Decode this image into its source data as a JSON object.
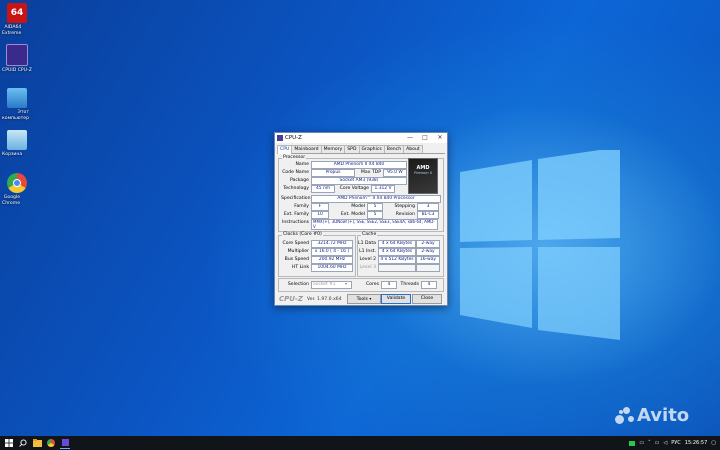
{
  "desktop": {
    "icons": [
      {
        "label": "AIDA64\nExtreme",
        "glyph": "64",
        "icon": "aida64-icon",
        "color": "#c81414"
      },
      {
        "label": "CPUID CPU-Z",
        "glyph": "",
        "icon": "cpuz-icon",
        "color": "#3a2a8a"
      },
      {
        "label": "Этот\nкомпьютер",
        "glyph": "",
        "icon": "computer-icon",
        "color": "#2a8ad8"
      },
      {
        "label": "Корзина",
        "glyph": "",
        "icon": "recycle-bin-icon",
        "color": "#6ab0e0"
      },
      {
        "label": "Google\nChrome",
        "glyph": "",
        "icon": "chrome-icon",
        "color": "#e84a3a"
      }
    ]
  },
  "window": {
    "title": "CPU-Z",
    "controls": {
      "minimize": "—",
      "maximize": "□",
      "close": "✕"
    },
    "tabs": [
      "CPU",
      "Mainboard",
      "Memory",
      "SPD",
      "Graphics",
      "Bench",
      "About"
    ],
    "active_tab": "CPU",
    "processor": {
      "group_label": "Processor",
      "name_label": "Name",
      "name": "AMD Phenom II X4 840",
      "codename_label": "Code Name",
      "codename": "Propus",
      "maxtdp_label": "Max TDP",
      "maxtdp": "95.0 W",
      "package_label": "Package",
      "package": "Socket AM3 (938)",
      "technology_label": "Technology",
      "technology": "45 nm",
      "corevoltage_label": "Core Voltage",
      "corevoltage": "1.312 V",
      "spec_label": "Specification",
      "spec": "AMD Phenom™ II X4 840 Processor",
      "family_label": "Family",
      "family": "F",
      "model_label": "Model",
      "model": "5",
      "stepping_label": "Stepping",
      "stepping": "3",
      "extfamily_label": "Ext. Family",
      "extfamily": "10",
      "extmodel_label": "Ext. Model",
      "extmodel": "5",
      "revision_label": "Revision",
      "revision": "BL-C3",
      "instructions_label": "Instructions",
      "instructions": "MMX(+), 3DNow!(+), SSE, SSE2, SSE3, SSE4A, x86-64, AMD-V"
    },
    "amd_logo": {
      "brand": "AMD",
      "sub": "Phenom II"
    },
    "clocks": {
      "group_label": "Clocks (Core #0)",
      "corespeed_label": "Core Speed",
      "corespeed": "3214.72 MHz",
      "multiplier_label": "Multiplier",
      "multiplier": "x 16.0 ( 4 - 16 )",
      "busspeed_label": "Bus Speed",
      "busspeed": "200.92 MHz",
      "htlink_label": "HT Link",
      "htlink": "1004.60 MHz"
    },
    "cache": {
      "group_label": "Cache",
      "l1data_label": "L1 Data",
      "l1data": "4 x 64 KBytes",
      "l1data_way": "2-way",
      "l1inst_label": "L1 Inst.",
      "l1inst": "4 x 64 KBytes",
      "l1inst_way": "2-way",
      "level2_label": "Level 2",
      "level2": "4 x 512 KBytes",
      "level2_way": "16-way",
      "level3_label": "Level 3"
    },
    "selection_label": "Selection",
    "selection": "Socket #1",
    "cores_label": "Cores",
    "cores": "4",
    "threads_label": "Threads",
    "threads": "4",
    "footer": {
      "logo": "CPU-Z",
      "version": "Ver. 1.97.0.x64",
      "tools": "Tools",
      "validate": "Validate",
      "close": "Close"
    }
  },
  "taskbar": {
    "tray_lang": "РУС",
    "time": "15:26:57"
  },
  "watermark": "Avito"
}
